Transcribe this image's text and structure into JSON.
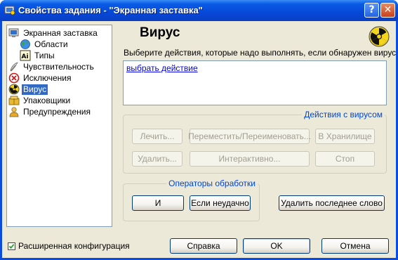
{
  "window": {
    "title": "Свойства задания - \"Экранная заставка\""
  },
  "titlebar_buttons": {
    "help": "?",
    "close": "✕"
  },
  "tree": {
    "items": [
      {
        "label": "Экранная заставка",
        "icon": "screensaver-icon"
      },
      {
        "label": "Области",
        "icon": "globe-icon"
      },
      {
        "label": "Типы",
        "icon": "file-types-icon"
      },
      {
        "label": "Чувствительность",
        "icon": "feather-icon"
      },
      {
        "label": "Исключения",
        "icon": "exclusion-icon"
      },
      {
        "label": "Вирус",
        "icon": "radiation-icon",
        "selected": true
      },
      {
        "label": "Упаковщики",
        "icon": "packer-icon"
      },
      {
        "label": "Предупреждения",
        "icon": "user-alert-icon"
      }
    ]
  },
  "panel": {
    "title": "Вирус",
    "description": "Выберите действия, которые надо выполнять, если обнаружен вирус",
    "action_link": "выбрать действие"
  },
  "virus_actions": {
    "title": "Действия с вирусом",
    "buttons": {
      "cure": "Лечить...",
      "move": "Переместить/Переименовать...",
      "vault": "В Хранилище",
      "delete": "Удалить...",
      "interactive": "Интерактивно...",
      "stop": "Стоп"
    }
  },
  "operators": {
    "title": "Операторы обработки",
    "and": "И",
    "if_failed": "Если неудачно",
    "delete_last": "Удалить последнее слово"
  },
  "footer": {
    "extended_config": "Расширенная конфигурация",
    "extended_checked": true,
    "help": "Справка",
    "ok": "OK",
    "cancel": "Отмена"
  },
  "colors": {
    "title_blue": "#0a5ce6",
    "selection": "#316ac5",
    "group_title": "#0046d5",
    "dialog_bg": "#ece9d8"
  }
}
